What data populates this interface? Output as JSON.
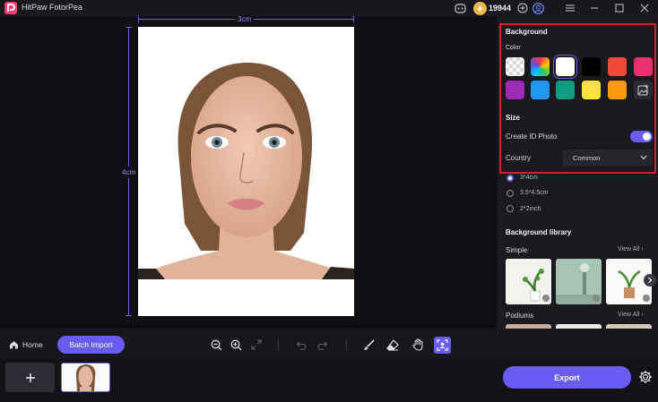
{
  "app": {
    "title": "HitPaw FotorPea",
    "coins": "19944"
  },
  "canvas": {
    "width_label": "3cm",
    "height_label": "4cm"
  },
  "panel": {
    "background_title": "Background",
    "color_label": "Color",
    "swatches": [
      {
        "name": "transparent",
        "color": "checker"
      },
      {
        "name": "gradient",
        "color": "rainbow"
      },
      {
        "name": "white",
        "color": "#ffffff",
        "selected": true
      },
      {
        "name": "black",
        "color": "#000000"
      },
      {
        "name": "red",
        "color": "#f04a36"
      },
      {
        "name": "pink",
        "color": "#e8306f"
      },
      {
        "name": "purple",
        "color": "#9b2ab7"
      },
      {
        "name": "blue",
        "color": "#2196f3"
      },
      {
        "name": "teal",
        "color": "#0f9a82"
      },
      {
        "name": "yellow",
        "color": "#fde33b"
      },
      {
        "name": "orange",
        "color": "#ff9a0a"
      },
      {
        "name": "custom-image",
        "color": "image-icon"
      }
    ],
    "size_title": "Size",
    "create_id_label": "Create ID Photo",
    "create_id_on": true,
    "country_label": "Country",
    "country_value": "Common",
    "size_options": [
      {
        "label": "3*4cm",
        "selected": true
      },
      {
        "label": "3.5*4.5cm",
        "selected": false
      },
      {
        "label": "2*2inch",
        "selected": false
      }
    ],
    "library_title": "Background library",
    "simple_label": "Simple",
    "podiums_label": "Podiums",
    "view_all": "View All"
  },
  "toolbar": {
    "home": "Home",
    "batch_import": "Batch Import"
  },
  "export": "Export",
  "colors": {
    "accent": "#6a5cf2",
    "highlight_border": "#d3202e"
  }
}
